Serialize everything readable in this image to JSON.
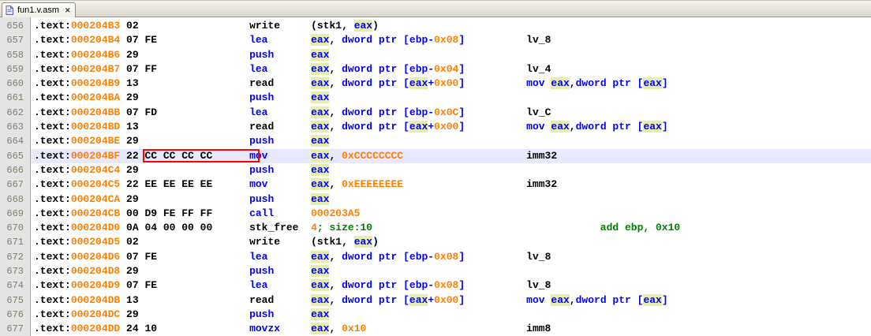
{
  "tab": {
    "title": "fun1.v.asm",
    "close_glyph": "✕"
  },
  "colors": {
    "keyword": "#0000FF",
    "number": "#FF8000",
    "comment": "#008000",
    "current_line_bg": "#E8E8FF",
    "register_highlight_bg": "#E7EDAD",
    "patch_box_border": "#FF0000",
    "gutter_bg": "#E4E4E4"
  },
  "editor": {
    "lines": [
      {
        "n": "656",
        "segs": [
          [
            ".text:",
            "d"
          ],
          [
            "000204B3",
            "a"
          ],
          [
            " 02                  ",
            "d"
          ],
          [
            "write     ",
            "d"
          ],
          [
            "(stk1, ",
            "d"
          ],
          [
            "eax",
            "h"
          ],
          [
            ")",
            "d"
          ]
        ]
      },
      {
        "n": "657",
        "segs": [
          [
            ".text:",
            "d"
          ],
          [
            "000204B4",
            "a"
          ],
          [
            " 07 FE               ",
            "d"
          ],
          [
            "lea       ",
            "k"
          ],
          [
            "eax",
            "h"
          ],
          [
            ", ",
            "d"
          ],
          [
            "dword ptr [ebp-",
            "k"
          ],
          [
            "0x08",
            "n"
          ],
          [
            "]",
            "k"
          ],
          [
            "          lv_8",
            "d"
          ]
        ]
      },
      {
        "n": "658",
        "segs": [
          [
            ".text:",
            "d"
          ],
          [
            "000204B6",
            "a"
          ],
          [
            " 29                  ",
            "d"
          ],
          [
            "push      ",
            "k"
          ],
          [
            "eax",
            "h"
          ]
        ]
      },
      {
        "n": "659",
        "segs": [
          [
            ".text:",
            "d"
          ],
          [
            "000204B7",
            "a"
          ],
          [
            " 07 FF               ",
            "d"
          ],
          [
            "lea       ",
            "k"
          ],
          [
            "eax",
            "h"
          ],
          [
            ", ",
            "d"
          ],
          [
            "dword ptr [ebp-",
            "k"
          ],
          [
            "0x04",
            "n"
          ],
          [
            "]",
            "k"
          ],
          [
            "          lv_4",
            "d"
          ]
        ]
      },
      {
        "n": "660",
        "segs": [
          [
            ".text:",
            "d"
          ],
          [
            "000204B9",
            "a"
          ],
          [
            " 13                  ",
            "d"
          ],
          [
            "read      ",
            "d"
          ],
          [
            "eax",
            "h"
          ],
          [
            ", ",
            "d"
          ],
          [
            "dword ptr [",
            "k"
          ],
          [
            "eax",
            "h"
          ],
          [
            "+",
            "k"
          ],
          [
            "0x00",
            "n"
          ],
          [
            "]",
            "k"
          ],
          [
            "          mov ",
            "k"
          ],
          [
            "eax",
            "h"
          ],
          [
            ",",
            "d"
          ],
          [
            "dword ptr [",
            "k"
          ],
          [
            "eax",
            "h"
          ],
          [
            "]",
            "k"
          ]
        ]
      },
      {
        "n": "661",
        "segs": [
          [
            ".text:",
            "d"
          ],
          [
            "000204BA",
            "a"
          ],
          [
            " 29                  ",
            "d"
          ],
          [
            "push      ",
            "k"
          ],
          [
            "eax",
            "h"
          ]
        ]
      },
      {
        "n": "662",
        "segs": [
          [
            ".text:",
            "d"
          ],
          [
            "000204BB",
            "a"
          ],
          [
            " 07 FD               ",
            "d"
          ],
          [
            "lea       ",
            "k"
          ],
          [
            "eax",
            "h"
          ],
          [
            ", ",
            "d"
          ],
          [
            "dword ptr [ebp-",
            "k"
          ],
          [
            "0x0C",
            "n"
          ],
          [
            "]",
            "k"
          ],
          [
            "          lv_C",
            "d"
          ]
        ]
      },
      {
        "n": "663",
        "segs": [
          [
            ".text:",
            "d"
          ],
          [
            "000204BD",
            "a"
          ],
          [
            " 13                  ",
            "d"
          ],
          [
            "read      ",
            "d"
          ],
          [
            "eax",
            "h"
          ],
          [
            ", ",
            "d"
          ],
          [
            "dword ptr [",
            "k"
          ],
          [
            "eax",
            "h"
          ],
          [
            "+",
            "k"
          ],
          [
            "0x00",
            "n"
          ],
          [
            "]",
            "k"
          ],
          [
            "          mov ",
            "k"
          ],
          [
            "eax",
            "h"
          ],
          [
            ",",
            "d"
          ],
          [
            "dword ptr [",
            "k"
          ],
          [
            "eax",
            "h"
          ],
          [
            "]",
            "k"
          ]
        ]
      },
      {
        "n": "664",
        "segs": [
          [
            ".text:",
            "d"
          ],
          [
            "000204BE",
            "a"
          ],
          [
            " 29                  ",
            "d"
          ],
          [
            "push      ",
            "k"
          ],
          [
            "eax",
            "h"
          ]
        ]
      },
      {
        "n": "665",
        "cur": true,
        "box": {
          "left_ch": 17.7,
          "width_ch": 19
        },
        "segs": [
          [
            ".text:",
            "d"
          ],
          [
            "000204BF",
            "a"
          ],
          [
            " 22 CC CC CC CC      ",
            "d"
          ],
          [
            "mov       ",
            "k"
          ],
          [
            "eax",
            "h"
          ],
          [
            ", ",
            "d"
          ],
          [
            "0xCCCCCCCC",
            "n"
          ],
          [
            "                    imm32",
            "d"
          ]
        ]
      },
      {
        "n": "666",
        "segs": [
          [
            ".text:",
            "d"
          ],
          [
            "000204C4",
            "a"
          ],
          [
            " 29                  ",
            "d"
          ],
          [
            "push      ",
            "k"
          ],
          [
            "eax",
            "h"
          ]
        ]
      },
      {
        "n": "667",
        "segs": [
          [
            ".text:",
            "d"
          ],
          [
            "000204C5",
            "a"
          ],
          [
            " 22 EE EE EE EE      ",
            "d"
          ],
          [
            "mov       ",
            "k"
          ],
          [
            "eax",
            "h"
          ],
          [
            ", ",
            "d"
          ],
          [
            "0xEEEEEEEE",
            "n"
          ],
          [
            "                    imm32",
            "d"
          ]
        ]
      },
      {
        "n": "668",
        "segs": [
          [
            ".text:",
            "d"
          ],
          [
            "000204CA",
            "a"
          ],
          [
            " 29                  ",
            "d"
          ],
          [
            "push      ",
            "k"
          ],
          [
            "eax",
            "h"
          ]
        ]
      },
      {
        "n": "669",
        "segs": [
          [
            ".text:",
            "d"
          ],
          [
            "000204CB",
            "a"
          ],
          [
            " 00 D9 FE FF FF      ",
            "d"
          ],
          [
            "call      ",
            "k"
          ],
          [
            "000203A5",
            "n"
          ]
        ]
      },
      {
        "n": "670",
        "segs": [
          [
            ".text:",
            "d"
          ],
          [
            "000204D0",
            "a"
          ],
          [
            " 0A 04 00 00 00      ",
            "d"
          ],
          [
            "stk_free  ",
            "d"
          ],
          [
            "4",
            "n"
          ],
          [
            "; size:10",
            "c"
          ],
          [
            "                                     ",
            "d"
          ],
          [
            "add ebp, 0x10",
            "c"
          ]
        ]
      },
      {
        "n": "671",
        "segs": [
          [
            ".text:",
            "d"
          ],
          [
            "000204D5",
            "a"
          ],
          [
            " 02                  ",
            "d"
          ],
          [
            "write     ",
            "d"
          ],
          [
            "(stk1, ",
            "d"
          ],
          [
            "eax",
            "h"
          ],
          [
            ")",
            "d"
          ]
        ]
      },
      {
        "n": "672",
        "segs": [
          [
            ".text:",
            "d"
          ],
          [
            "000204D6",
            "a"
          ],
          [
            " 07 FE               ",
            "d"
          ],
          [
            "lea       ",
            "k"
          ],
          [
            "eax",
            "h"
          ],
          [
            ", ",
            "d"
          ],
          [
            "dword ptr [ebp-",
            "k"
          ],
          [
            "0x08",
            "n"
          ],
          [
            "]",
            "k"
          ],
          [
            "          lv_8",
            "d"
          ]
        ]
      },
      {
        "n": "673",
        "segs": [
          [
            ".text:",
            "d"
          ],
          [
            "000204D8",
            "a"
          ],
          [
            " 29                  ",
            "d"
          ],
          [
            "push      ",
            "k"
          ],
          [
            "eax",
            "h"
          ]
        ]
      },
      {
        "n": "674",
        "segs": [
          [
            ".text:",
            "d"
          ],
          [
            "000204D9",
            "a"
          ],
          [
            " 07 FE               ",
            "d"
          ],
          [
            "lea       ",
            "k"
          ],
          [
            "eax",
            "h"
          ],
          [
            ", ",
            "d"
          ],
          [
            "dword ptr [ebp-",
            "k"
          ],
          [
            "0x08",
            "n"
          ],
          [
            "]",
            "k"
          ],
          [
            "          lv_8",
            "d"
          ]
        ]
      },
      {
        "n": "675",
        "segs": [
          [
            ".text:",
            "d"
          ],
          [
            "000204DB",
            "a"
          ],
          [
            " 13                  ",
            "d"
          ],
          [
            "read      ",
            "d"
          ],
          [
            "eax",
            "h"
          ],
          [
            ", ",
            "d"
          ],
          [
            "dword ptr [",
            "k"
          ],
          [
            "eax",
            "h"
          ],
          [
            "+",
            "k"
          ],
          [
            "0x00",
            "n"
          ],
          [
            "]",
            "k"
          ],
          [
            "          mov ",
            "k"
          ],
          [
            "eax",
            "h"
          ],
          [
            ",",
            "d"
          ],
          [
            "dword ptr [",
            "k"
          ],
          [
            "eax",
            "h"
          ],
          [
            "]",
            "k"
          ]
        ]
      },
      {
        "n": "676",
        "segs": [
          [
            ".text:",
            "d"
          ],
          [
            "000204DC",
            "a"
          ],
          [
            " 29                  ",
            "d"
          ],
          [
            "push      ",
            "k"
          ],
          [
            "eax",
            "h"
          ]
        ]
      },
      {
        "n": "677",
        "segs": [
          [
            ".text:",
            "d"
          ],
          [
            "000204DD",
            "a"
          ],
          [
            " 24 10               ",
            "d"
          ],
          [
            "movzx     ",
            "k"
          ],
          [
            "eax",
            "h"
          ],
          [
            ", ",
            "d"
          ],
          [
            "0x10",
            "n"
          ],
          [
            "                          imm8",
            "d"
          ]
        ]
      }
    ]
  }
}
